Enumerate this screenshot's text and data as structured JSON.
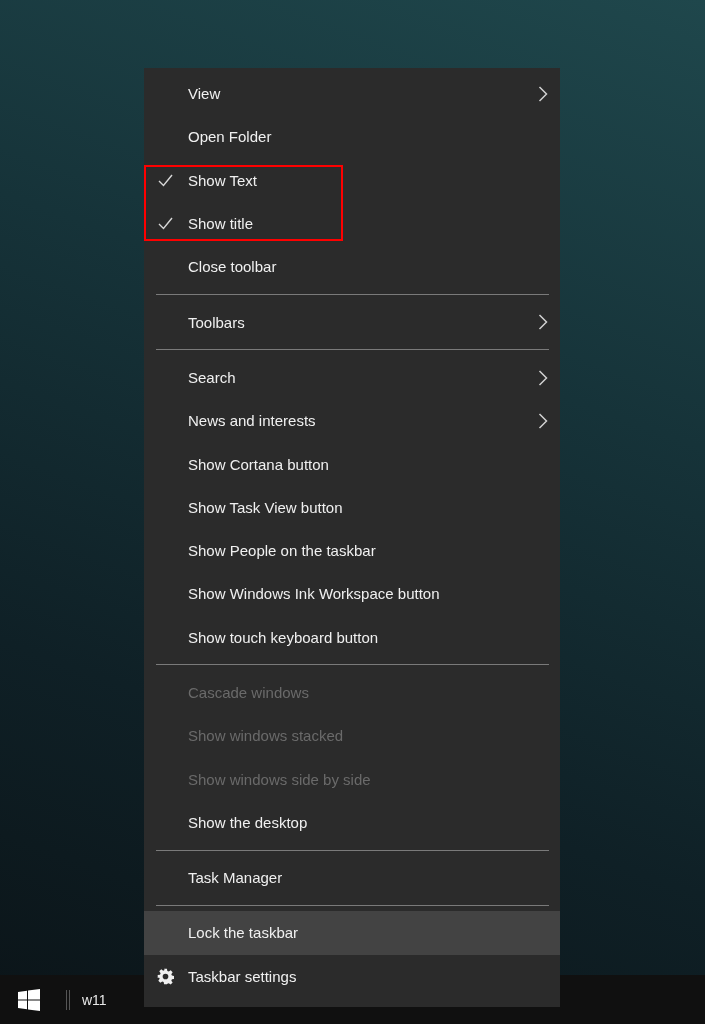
{
  "context_menu": {
    "items": [
      {
        "kind": "item",
        "label": "View",
        "checked": false,
        "submenu": true,
        "disabled": false,
        "selected": false
      },
      {
        "kind": "item",
        "label": "Open Folder",
        "checked": false,
        "submenu": false,
        "disabled": false,
        "selected": false
      },
      {
        "kind": "item",
        "label": "Show Text",
        "checked": true,
        "submenu": false,
        "disabled": false,
        "selected": false
      },
      {
        "kind": "item",
        "label": "Show title",
        "checked": true,
        "submenu": false,
        "disabled": false,
        "selected": false
      },
      {
        "kind": "item",
        "label": "Close toolbar",
        "checked": false,
        "submenu": false,
        "disabled": false,
        "selected": false
      },
      {
        "kind": "separator"
      },
      {
        "kind": "item",
        "label": "Toolbars",
        "checked": false,
        "submenu": true,
        "disabled": false,
        "selected": false
      },
      {
        "kind": "separator"
      },
      {
        "kind": "item",
        "label": "Search",
        "checked": false,
        "submenu": true,
        "disabled": false,
        "selected": false
      },
      {
        "kind": "item",
        "label": "News and interests",
        "checked": false,
        "submenu": true,
        "disabled": false,
        "selected": false
      },
      {
        "kind": "item",
        "label": "Show Cortana button",
        "checked": false,
        "submenu": false,
        "disabled": false,
        "selected": false
      },
      {
        "kind": "item",
        "label": "Show Task View button",
        "checked": false,
        "submenu": false,
        "disabled": false,
        "selected": false
      },
      {
        "kind": "item",
        "label": "Show People on the taskbar",
        "checked": false,
        "submenu": false,
        "disabled": false,
        "selected": false
      },
      {
        "kind": "item",
        "label": "Show Windows Ink Workspace button",
        "checked": false,
        "submenu": false,
        "disabled": false,
        "selected": false
      },
      {
        "kind": "item",
        "label": "Show touch keyboard button",
        "checked": false,
        "submenu": false,
        "disabled": false,
        "selected": false
      },
      {
        "kind": "separator"
      },
      {
        "kind": "item",
        "label": "Cascade windows",
        "checked": false,
        "submenu": false,
        "disabled": true,
        "selected": false
      },
      {
        "kind": "item",
        "label": "Show windows stacked",
        "checked": false,
        "submenu": false,
        "disabled": true,
        "selected": false
      },
      {
        "kind": "item",
        "label": "Show windows side by side",
        "checked": false,
        "submenu": false,
        "disabled": true,
        "selected": false
      },
      {
        "kind": "item",
        "label": "Show the desktop",
        "checked": false,
        "submenu": false,
        "disabled": false,
        "selected": false
      },
      {
        "kind": "separator"
      },
      {
        "kind": "item",
        "label": "Task Manager",
        "checked": false,
        "submenu": false,
        "disabled": false,
        "selected": false
      },
      {
        "kind": "separator"
      },
      {
        "kind": "item",
        "label": "Lock the taskbar",
        "checked": false,
        "submenu": false,
        "disabled": false,
        "selected": true
      },
      {
        "kind": "settings",
        "label": "Taskbar settings",
        "checked": false,
        "submenu": false,
        "disabled": false,
        "selected": false
      }
    ]
  },
  "taskbar": {
    "toolbar_label": "w11"
  }
}
